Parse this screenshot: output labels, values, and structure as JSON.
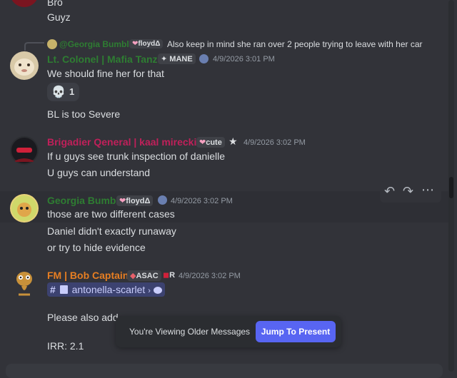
{
  "colors": {
    "bg": "#323339",
    "name_red": "#c0205a",
    "name_green": "#2e7d32",
    "name_orange": "#e67e22",
    "accent": "#5865f2"
  },
  "messages": {
    "m0": {
      "lines": [
        "Bro",
        "Guyz"
      ]
    },
    "m1": {
      "reply": {
        "author": "@Georgia Bumble",
        "tag": "floydΔ",
        "text": "Also keep in mind she ran over 2 people trying to leave with her car"
      },
      "author": "Lt. Colonel | Mafia Tanzir",
      "tag": "MANE",
      "timestamp": "4/9/2026 3:01 PM",
      "lines": [
        "We should fine her for that"
      ],
      "reaction": {
        "icon": "skull-icon",
        "count": "1"
      },
      "followup": "BL is too Severe"
    },
    "m2": {
      "author": "Brigadier Qeneral | kaal mirecki",
      "tag": "cute",
      "timestamp": "4/9/2026 3:02 PM",
      "lines": [
        "If u guys see trunk inspection of danielle",
        "U guys can understand"
      ]
    },
    "m3": {
      "author": "Georgia Bumble",
      "tag": "floydΔ",
      "timestamp": "4/9/2026 3:02 PM",
      "lines": [
        "those are two different cases",
        "Daniel didn't exactly runaway",
        "or try to hide evidence"
      ]
    },
    "m4": {
      "author": "FM | Bob Captain",
      "tag": "ASAC",
      "tag2": "R",
      "timestamp": "4/9/2026 3:02 PM",
      "channel_mention": "antonella-scarlet",
      "lines": [
        "Please also add",
        "IRR: 2.1"
      ]
    }
  },
  "banner": {
    "text": "You're Viewing Older Messages",
    "button": "Jump To Present"
  }
}
